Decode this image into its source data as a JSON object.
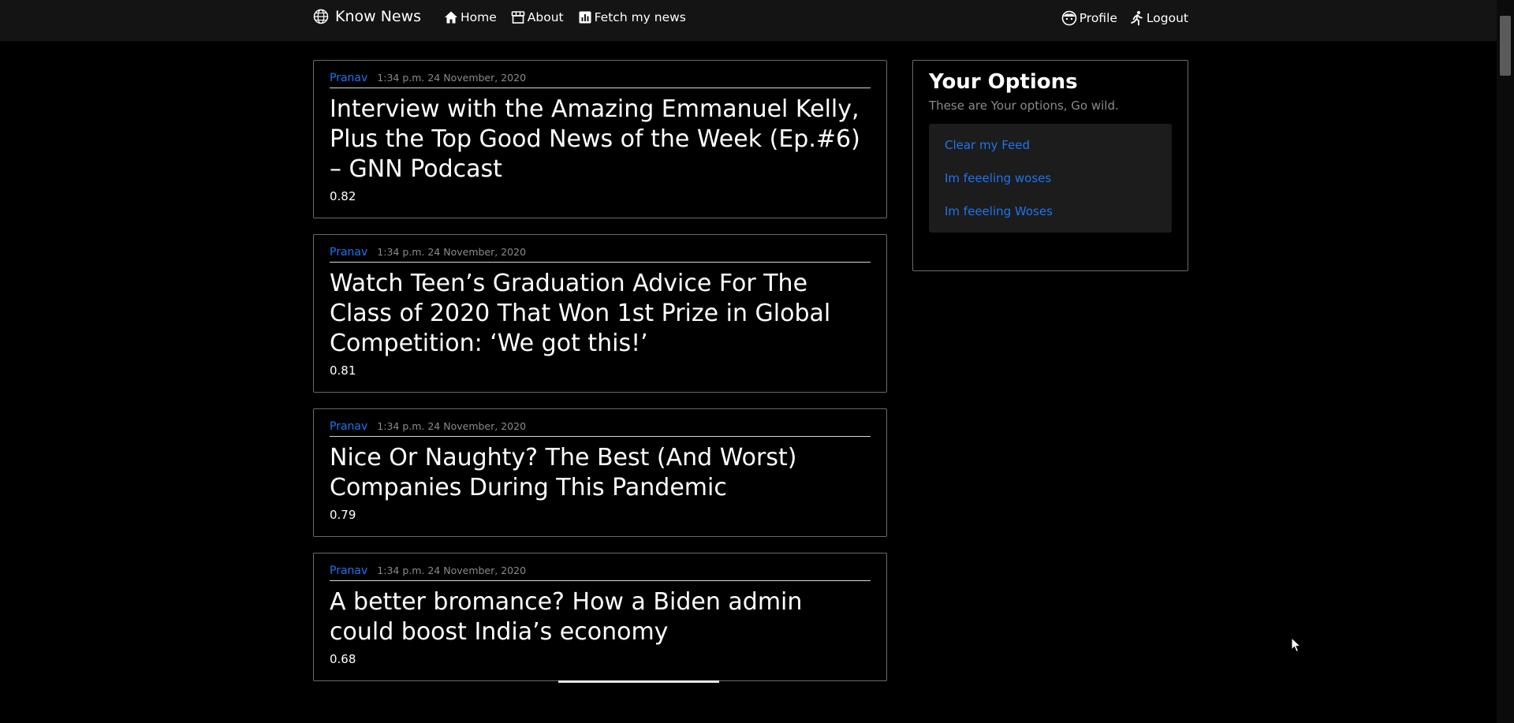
{
  "navbar": {
    "brand": "Know News",
    "links": [
      {
        "label": "Home",
        "icon": "home-icon"
      },
      {
        "label": "About",
        "icon": "storefront-icon"
      },
      {
        "label": "Fetch my news",
        "icon": "chart-icon"
      }
    ],
    "right": [
      {
        "label": "Profile",
        "icon": "face-icon"
      },
      {
        "label": "Logout",
        "icon": "running-person-icon"
      }
    ]
  },
  "feed": {
    "items": [
      {
        "author": "Pranav",
        "date": "1:34 p.m. 24 November, 2020",
        "title": "Interview with the Amazing Emmanuel Kelly, Plus the Top Good News of the Week (Ep.#6) – GNN Podcast",
        "score": "0.82"
      },
      {
        "author": "Pranav",
        "date": "1:34 p.m. 24 November, 2020",
        "title": "Watch Teen’s Graduation Advice For The Class of 2020 That Won 1st Prize in Global Competition: ‘We got this!’",
        "score": "0.81"
      },
      {
        "author": "Pranav",
        "date": "1:34 p.m. 24 November, 2020",
        "title": "Nice Or Naughty? The Best (And Worst) Companies During This Pandemic",
        "score": "0.79"
      },
      {
        "author": "Pranav",
        "date": "1:34 p.m. 24 November, 2020",
        "title": "A better bromance? How a Biden admin could boost India’s economy",
        "score": "0.68"
      }
    ]
  },
  "options": {
    "title": "Your Options",
    "subtitle": "These are Your options, Go wild.",
    "items": [
      "Clear my Feed",
      "Im feeeling woses",
      "Im feeeling Woses"
    ]
  },
  "colors": {
    "background": "#000000",
    "navbar": "#141414",
    "link": "#1e74f0",
    "muted": "#8a8a8a"
  }
}
